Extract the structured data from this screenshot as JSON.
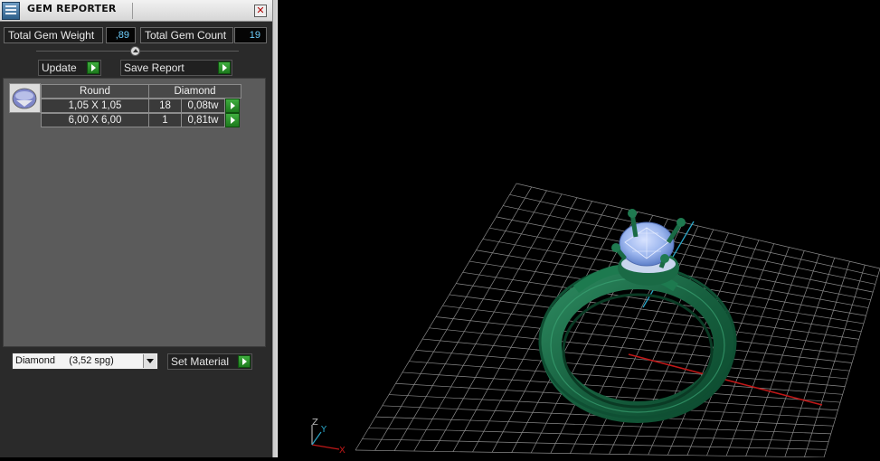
{
  "window": {
    "title": "GEM REPORTER",
    "close_label": "✕"
  },
  "summary": {
    "weight_label": "Total Gem Weight",
    "weight_value": ",89",
    "count_label": "Total Gem Count",
    "count_value": "19"
  },
  "buttons": {
    "update_label": "Update",
    "save_label": "Save Report",
    "set_material_label": "Set Material"
  },
  "table": {
    "columns": [
      "Round",
      "Diamond"
    ],
    "rows": [
      {
        "size": "1,05 X 1,05",
        "count": "18",
        "weight": "0,08tw"
      },
      {
        "size": "6,00 X 6,00",
        "count": "1",
        "weight": "0,81tw"
      }
    ]
  },
  "material": {
    "selected": "Diamond     (3,52 spg)"
  },
  "viewport": {
    "axis_z": "Z",
    "axis_y": "Y",
    "axis_x": "X"
  },
  "colors": {
    "ring": "#1b6b4a",
    "gem": "#9cb6ee",
    "grid": "#8a8a8a",
    "x_axis": "#c01818",
    "y_axis": "#2aa6c8",
    "accent_value": "#6fd0ff"
  }
}
